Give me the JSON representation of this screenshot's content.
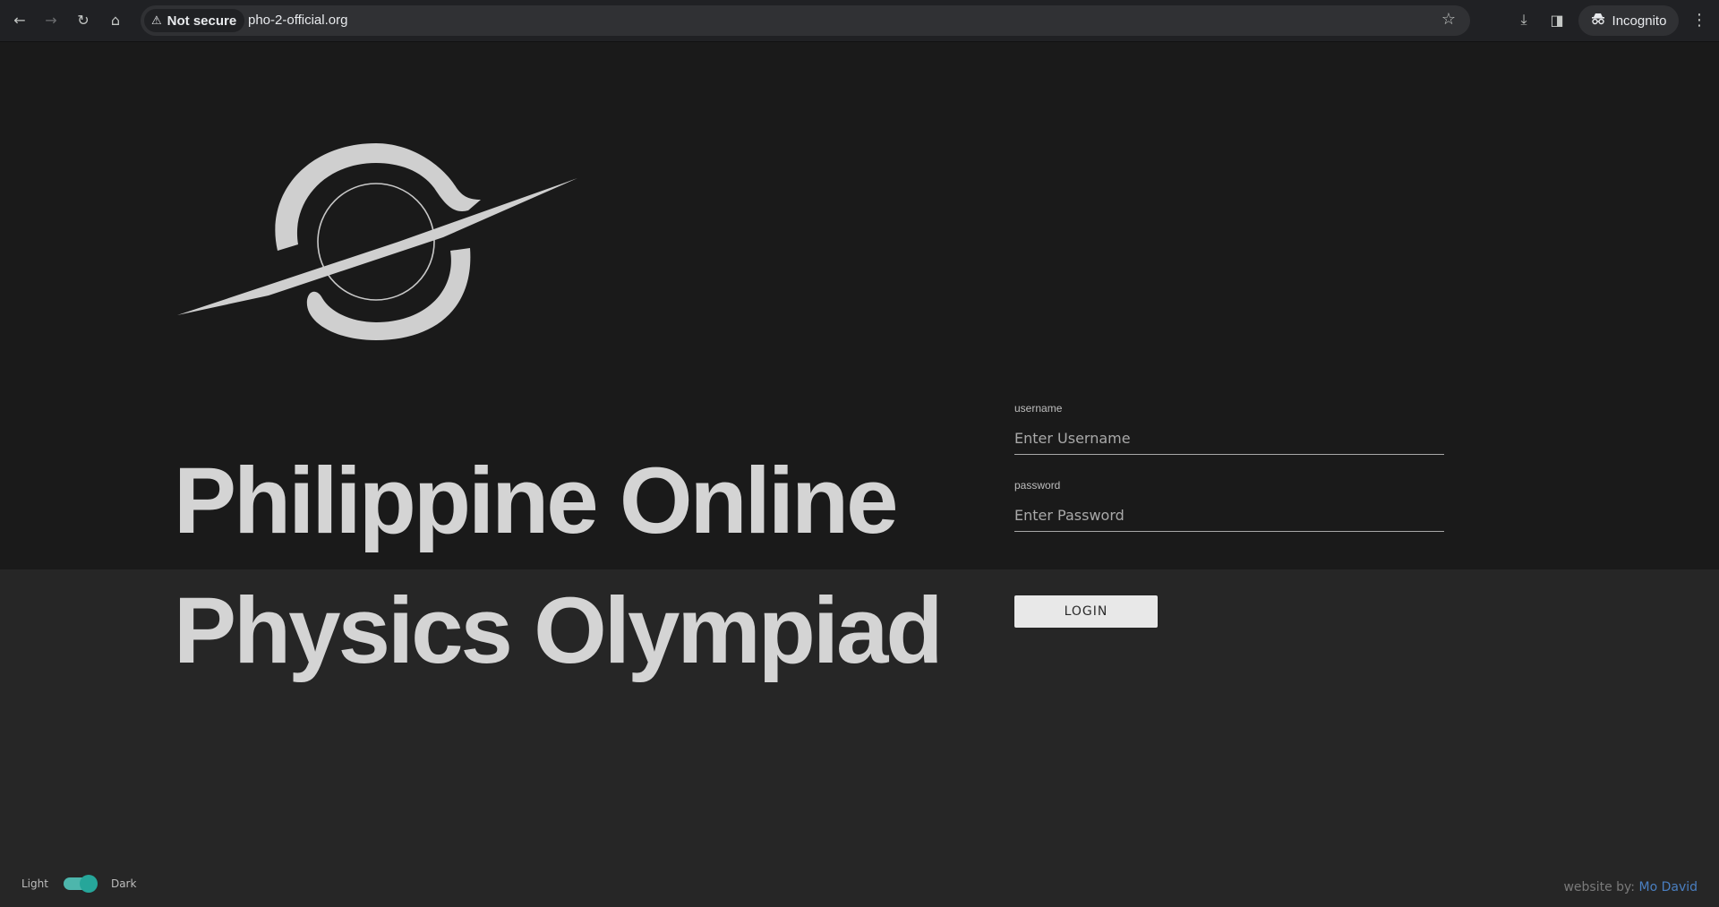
{
  "browser": {
    "back_icon": "←",
    "forward_icon": "→",
    "reload_icon": "↻",
    "home_icon": "⌂",
    "security_icon": "⚠",
    "security_label": "Not secure",
    "url": "pho-2-official.org",
    "bookmark_icon": "☆",
    "download_icon": "⤓",
    "sidepanel_icon": "◨",
    "incognito_icon": "🕶",
    "incognito_label": "Incognito",
    "menu_icon": "⋮"
  },
  "page": {
    "title_line_1": "Philippine Online",
    "title_line_2": "Physics Olympiad",
    "logo_icon": "orbit-planet-logo"
  },
  "login": {
    "username_label": "username",
    "username_placeholder": "Enter Username",
    "username_value": "",
    "password_label": "password",
    "password_placeholder": "Enter Password",
    "password_value": "",
    "button_label": "LOGIN"
  },
  "theme": {
    "light_label": "Light",
    "dark_label": "Dark",
    "is_dark": true,
    "accent": "#26a69a"
  },
  "footer": {
    "credit_prefix": "website by: ",
    "credit_name": "Mo David",
    "credit_color": "#4a7fc1"
  }
}
